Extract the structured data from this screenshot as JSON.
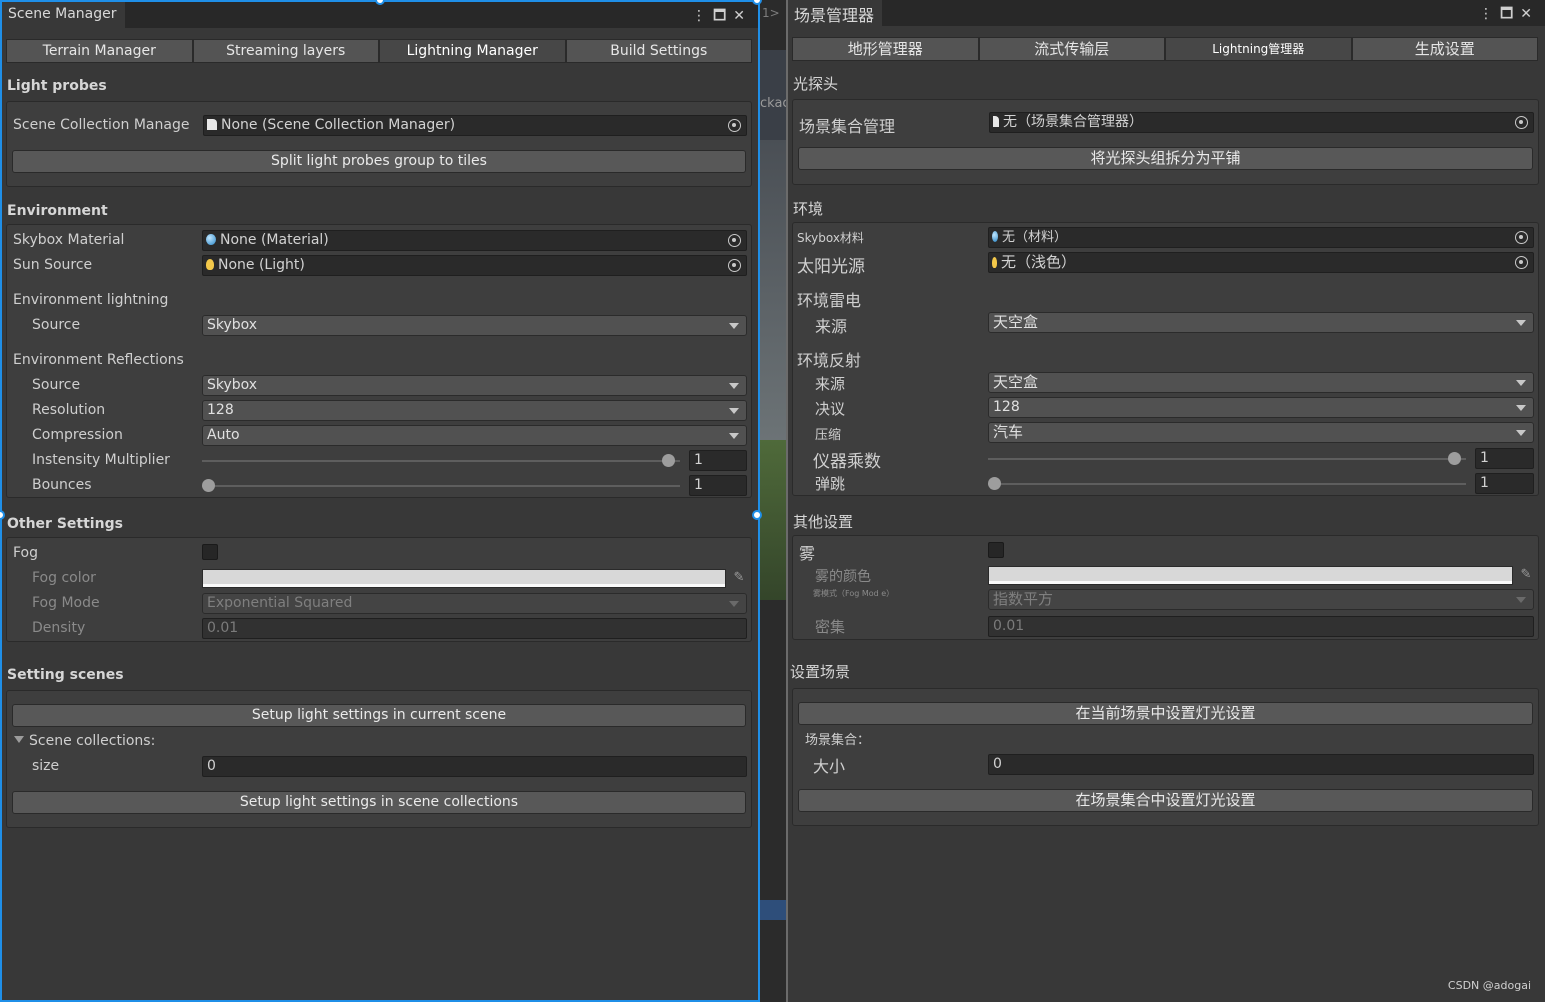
{
  "left": {
    "title": "Scene Manager",
    "tabs": [
      "Terrain Manager",
      "Streaming layers",
      "Lightning Manager",
      "Build Settings"
    ],
    "light_probes": {
      "title": "Light probes",
      "collection_label": "Scene Collection Manage",
      "collection_value": "None (Scene Collection Manager)",
      "split_button": "Split light probes group to tiles"
    },
    "environment": {
      "title": "Environment",
      "skybox_label": "Skybox Material",
      "skybox_value": "None (Material)",
      "sun_label": "Sun Source",
      "sun_value": "None (Light)",
      "lighting_header": "Environment lightning",
      "lighting_source_label": "Source",
      "lighting_source_value": "Skybox",
      "reflections_header": "Environment Reflections",
      "refl_source_label": "Source",
      "refl_source_value": "Skybox",
      "resolution_label": "Resolution",
      "resolution_value": "128",
      "compression_label": "Compression",
      "compression_value": "Auto",
      "intensity_label": "Instensity Multiplier",
      "intensity_value": "1",
      "bounces_label": "Bounces",
      "bounces_value": "1"
    },
    "other": {
      "title": "Other Settings",
      "fog_label": "Fog",
      "fog_color_label": "Fog color",
      "fog_mode_label": "Fog Mode",
      "fog_mode_value": "Exponential Squared",
      "density_label": "Density",
      "density_value": "0.01"
    },
    "setting_scenes": {
      "title": "Setting scenes",
      "current_button": "Setup light settings in current scene",
      "collections_label": "Scene collections:",
      "size_label": "size",
      "size_value": "0",
      "collections_button": "Setup light settings in scene collections"
    }
  },
  "right": {
    "title": "场景管理器",
    "tabs": [
      "地形管理器",
      "流式传输层",
      "Lightning管理器",
      "生成设置"
    ],
    "light_probes": {
      "title": "光探头",
      "collection_label": "场景集合管理",
      "collection_value": "无（场景集合管理器）",
      "split_button": "将光探头组拆分为平铺"
    },
    "environment": {
      "title": "环境",
      "skybox_label": "Skybox材料",
      "skybox_value": "无（材料）",
      "sun_label": "太阳光源",
      "sun_value": "无（浅色）",
      "lighting_header": "环境雷电",
      "lighting_source_label": "来源",
      "lighting_source_value": "天空盒",
      "reflections_header": "环境反射",
      "refl_source_label": "来源",
      "refl_source_value": "天空盒",
      "resolution_label": "决议",
      "resolution_value": "128",
      "compression_label": "压缩",
      "compression_value": "汽车",
      "intensity_label": "仪器乘数",
      "intensity_value": "1",
      "bounces_label": "弹跳",
      "bounces_value": "1"
    },
    "other": {
      "title": "其他设置",
      "fog_label": "雾",
      "fog_color_label": "雾的颜色",
      "fog_mode_label": "雾模式（Fog Mod e）",
      "fog_mode_value": "指数平方",
      "density_label": "密集",
      "density_value": "0.01"
    },
    "setting_scenes": {
      "title": "设置场景",
      "current_button": "在当前场景中设置灯光设置",
      "collections_label": "场景集合：",
      "size_label": "大小",
      "size_value": "0",
      "collections_button": "在场景集合中设置灯光设置"
    }
  },
  "gap_text": {
    "top": "1>",
    "mid": "ckac"
  },
  "watermark": "CSDN @adogai",
  "icons": {
    "window_menu": "⋮",
    "maximize": "maximize-icon",
    "close": "close-icon",
    "object_picker": "object-picker-icon",
    "eyedropper": "eyedropper-icon",
    "material": "material-sphere-icon",
    "light": "light-bulb-icon",
    "doc": "document-icon"
  },
  "sliders": {
    "intensity_fraction": 0.99,
    "bounces_fraction": 0.0
  },
  "colors": {
    "accent": "#1f8fe8",
    "panel": "#383838",
    "field": "#2a2a2a"
  }
}
